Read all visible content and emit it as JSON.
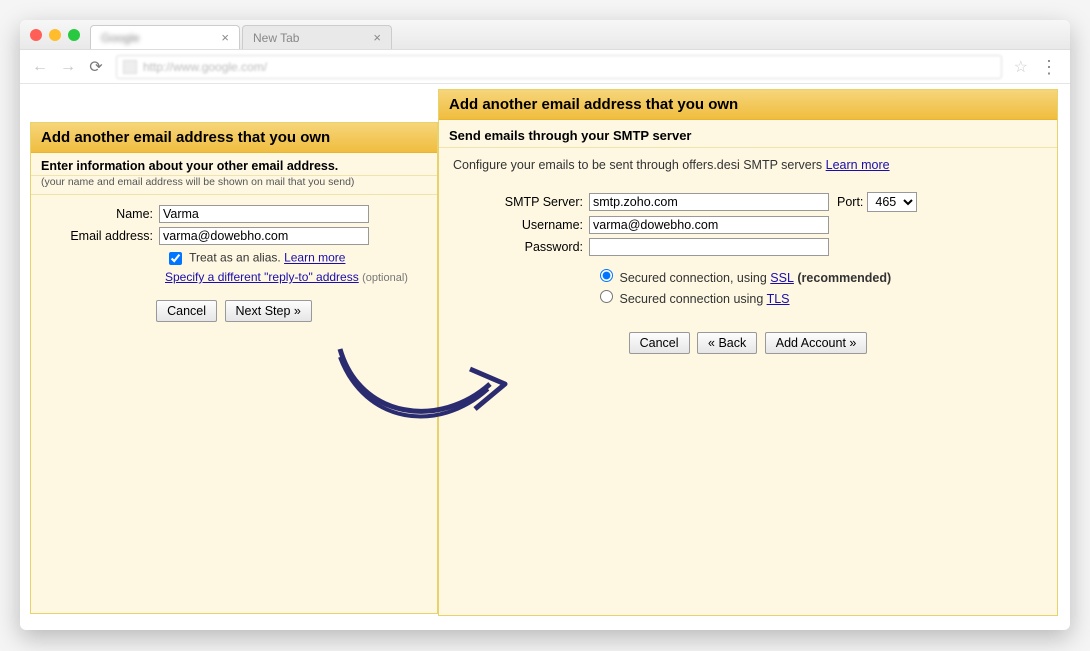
{
  "browser": {
    "tab1_title": "Google",
    "tab2_title": "New Tab",
    "url_display": "http://www.google.com/"
  },
  "left": {
    "title": "Add another email address that you own",
    "subtitle": "Enter information about your other email address.",
    "subnote": "(your name and email address will be shown on mail that you send)",
    "name_label": "Name:",
    "name_value": "Varma",
    "email_label": "Email address:",
    "email_value": "varma@dowebho.com",
    "alias_text": "Treat as an alias.",
    "learn_more": "Learn more",
    "replyto_link": "Specify a different \"reply-to\" address",
    "optional": "(optional)",
    "cancel": "Cancel",
    "next": "Next Step »"
  },
  "right": {
    "title": "Add another email address that you own",
    "subline": "Send emails through your SMTP server",
    "config_pre": "Configure your emails to be sent through offers.desi SMTP servers ",
    "learn_more": "Learn more",
    "smtp_label": "SMTP Server:",
    "smtp_value": "smtp.zoho.com",
    "port_label": "Port:",
    "port_value": "465",
    "user_label": "Username:",
    "user_value": "varma@dowebho.com",
    "pass_label": "Password:",
    "pass_value": "",
    "ssl_pre": "Secured connection, using ",
    "ssl_link": "SSL",
    "ssl_post": " (recommended)",
    "tls_pre": "Secured connection using ",
    "tls_link": "TLS",
    "cancel": "Cancel",
    "back": "« Back",
    "add": "Add Account »"
  }
}
